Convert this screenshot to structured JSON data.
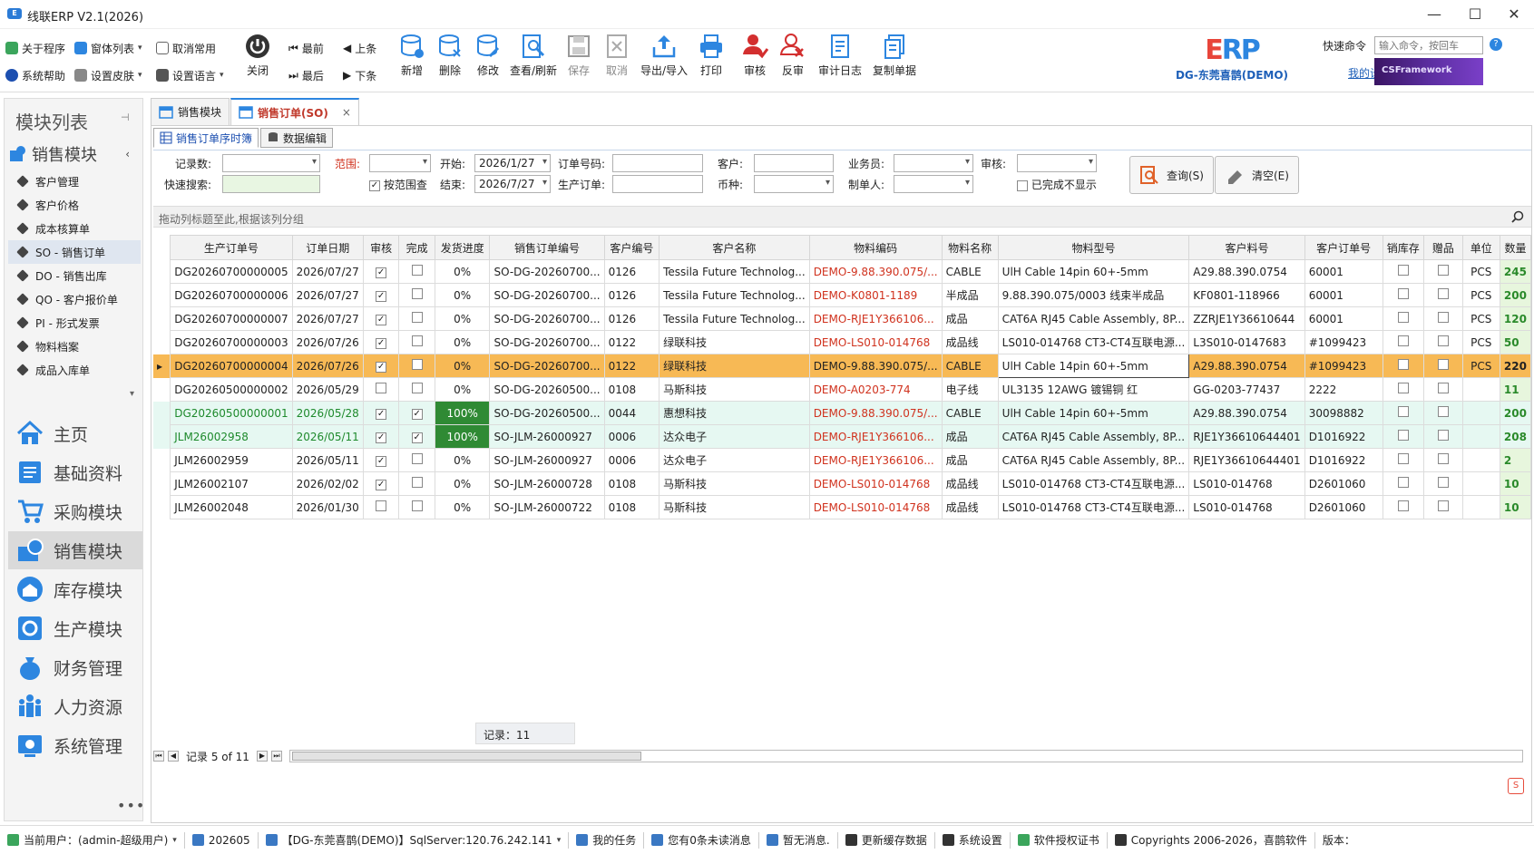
{
  "window": {
    "title": "线联ERP V2.1(2026)",
    "logo": "erp-logo-icon"
  },
  "ribbon": {
    "about": "关于程序",
    "window_list": "窗体列表",
    "cancel_favorite": "取消常用",
    "help": "系统帮助",
    "skin": "设置皮肤",
    "language": "设置语言",
    "close": "关闭",
    "first": "最前",
    "prev": "上条",
    "last": "最后",
    "next": "下条",
    "add": "新增",
    "delete": "删除",
    "edit": "修改",
    "view_refresh": "查看/刷新",
    "save": "保存",
    "cancel": "取消",
    "export_import": "导出/导入",
    "print": "打印",
    "approve": "审核",
    "unapprove": "反审",
    "audit_log": "审计日志",
    "copy_doc": "复制单据"
  },
  "brand": {
    "logo_text": "ERP",
    "org": "DG-东莞喜鹊(DEMO)",
    "cmd_label": "快速命令",
    "cmd_placeholder": "输入命令，按回车",
    "my_settings": "我的设置",
    "framework": "CSFramework",
    "help_icon": "?"
  },
  "sidebar": {
    "title": "模块列表",
    "pin": "ᵖ",
    "group": "销售模块",
    "items": [
      {
        "label": "客户管理"
      },
      {
        "label": "客户价格"
      },
      {
        "label": "成本核算单"
      },
      {
        "label": "SO - 销售订单"
      },
      {
        "label": "DO - 销售出库"
      },
      {
        "label": "QO - 客户报价单"
      },
      {
        "label": "PI - 形式发票"
      },
      {
        "label": "物料档案"
      },
      {
        "label": "成品入库单"
      }
    ],
    "nav": [
      {
        "label": "主页"
      },
      {
        "label": "基础资料"
      },
      {
        "label": "采购模块"
      },
      {
        "label": "销售模块"
      },
      {
        "label": "库存模块"
      },
      {
        "label": "生产模块"
      },
      {
        "label": "财务管理"
      },
      {
        "label": "人力资源"
      },
      {
        "label": "系统管理"
      }
    ],
    "more": "•••"
  },
  "tabs": [
    {
      "label": "销售模块"
    },
    {
      "label": "销售订单(SO)"
    }
  ],
  "subtabs": [
    {
      "label": "销售订单序时簿"
    },
    {
      "label": "数据编辑"
    }
  ],
  "filter": {
    "record_count": "记录数:",
    "quick_search": "快速搜索:",
    "range": "范围:",
    "by_range": "按范围查",
    "start": "开始:",
    "start_val": "2026/1/27",
    "end": "结束:",
    "end_val": "2026/7/27",
    "order_no": "订单号码:",
    "prod_order": "生产订单:",
    "customer": "客户:",
    "currency": "币种:",
    "salesman": "业务员:",
    "creator": "制单人:",
    "audit": "审核:",
    "hide_done": "已完成不显示",
    "query_btn": "查询(S)",
    "clear_btn": "清空(E)"
  },
  "group_hint": "拖动列标题至此,根据该列分组",
  "columns": [
    "生产订单号",
    "订单日期",
    "审核",
    "完成",
    "发货进度",
    "销售订单编号",
    "客户编号",
    "客户名称",
    "物料编码",
    "物料名称",
    "物料型号",
    "客户料号",
    "客户订单号",
    "销库存",
    "赠品",
    "单位",
    "数量"
  ],
  "rows": [
    {
      "prod": "DG20260700000005",
      "date": "2026/07/27",
      "aud": true,
      "done": false,
      "prog": "0%",
      "so": "SO-DG-20260700...",
      "cno": "0126",
      "cname": "Tessila Future Technolog...",
      "mcode": "DEMO-9.88.390.075/...",
      "mname": "CABLE",
      "model": "UlH Cable 14pin 60+-5mm",
      "cpn": "A29.88.390.0754",
      "cpo": "60001",
      "stock": false,
      "gift": false,
      "unit": "PCS",
      "qty": "245",
      "style": ""
    },
    {
      "prod": "DG20260700000006",
      "date": "2026/07/27",
      "aud": true,
      "done": false,
      "prog": "0%",
      "so": "SO-DG-20260700...",
      "cno": "0126",
      "cname": "Tessila Future Technolog...",
      "mcode": "DEMO-K0801-1189",
      "mname": "半成品",
      "model": "9.88.390.075/0003 线束半成品",
      "cpn": "KF0801-118966",
      "cpo": "60001",
      "stock": false,
      "gift": false,
      "unit": "PCS",
      "qty": "200",
      "style": ""
    },
    {
      "prod": "DG20260700000007",
      "date": "2026/07/27",
      "aud": true,
      "done": false,
      "prog": "0%",
      "so": "SO-DG-20260700...",
      "cno": "0126",
      "cname": "Tessila Future Technolog...",
      "mcode": "DEMO-RJE1Y366106...",
      "mname": "成品",
      "model": "CAT6A RJ45 Cable Assembly, 8P...",
      "cpn": "ZZRJE1Y36610644",
      "cpo": "60001",
      "stock": false,
      "gift": false,
      "unit": "PCS",
      "qty": "120",
      "style": ""
    },
    {
      "prod": "DG20260700000003",
      "date": "2026/07/26",
      "aud": true,
      "done": false,
      "prog": "0%",
      "so": "SO-DG-20260700...",
      "cno": "0122",
      "cname": "绿联科技",
      "mcode": "DEMO-LS010-014768",
      "mname": "成品线",
      "model": "LS010-014768 CT3-CT4互联电源...",
      "cpn": "L3S010-0147683",
      "cpo": "#1099423",
      "stock": false,
      "gift": false,
      "unit": "PCS",
      "qty": "50",
      "style": ""
    },
    {
      "prod": "DG20260700000004",
      "date": "2026/07/26",
      "aud": true,
      "done": false,
      "prog": "0%",
      "so": "SO-DG-20260700...",
      "cno": "0122",
      "cname": "绿联科技",
      "mcode": "DEMO-9.88.390.075/...",
      "mname": "CABLE",
      "model": "UlH Cable 14pin 60+-5mm",
      "cpn": "A29.88.390.0754",
      "cpo": "#1099423",
      "stock": false,
      "gift": false,
      "unit": "PCS",
      "qty": "220",
      "style": "sel"
    },
    {
      "prod": "DG20260500000002",
      "date": "2026/05/29",
      "aud": false,
      "done": false,
      "prog": "0%",
      "so": "SO-DG-20260500...",
      "cno": "0108",
      "cname": "马斯科技",
      "mcode": "DEMO-A0203-774",
      "mname": "电子线",
      "model": "UL3135 12AWG 镀锡铜 红",
      "cpn": "GG-0203-77437",
      "cpo": "2222",
      "stock": false,
      "gift": false,
      "unit": "",
      "qty": "11",
      "style": ""
    },
    {
      "prod": "DG20260500000001",
      "date": "2026/05/28",
      "aud": true,
      "done": true,
      "prog": "100%",
      "so": "SO-DG-20260500...",
      "cno": "0044",
      "cname": "惠想科技",
      "mcode": "DEMO-9.88.390.075/...",
      "mname": "CABLE",
      "model": "UlH Cable 14pin 60+-5mm",
      "cpn": "A29.88.390.0754",
      "cpo": "30098882",
      "stock": false,
      "gift": false,
      "unit": "",
      "qty": "200",
      "style": "green"
    },
    {
      "prod": "JLM26002958",
      "date": "2026/05/11",
      "aud": true,
      "done": true,
      "prog": "100%",
      "so": "SO-JLM-26000927",
      "cno": "0006",
      "cname": "达众电子",
      "mcode": "DEMO-RJE1Y366106...",
      "mname": "成品",
      "model": "CAT6A RJ45 Cable Assembly, 8P...",
      "cpn": "RJE1Y36610644401",
      "cpo": "D1016922",
      "stock": false,
      "gift": false,
      "unit": "",
      "qty": "208",
      "style": "green"
    },
    {
      "prod": "JLM26002959",
      "date": "2026/05/11",
      "aud": true,
      "done": false,
      "prog": "0%",
      "so": "SO-JLM-26000927",
      "cno": "0006",
      "cname": "达众电子",
      "mcode": "DEMO-RJE1Y366106...",
      "mname": "成品",
      "model": "CAT6A RJ45 Cable Assembly, 8P...",
      "cpn": "RJE1Y36610644401",
      "cpo": "D1016922",
      "stock": false,
      "gift": false,
      "unit": "",
      "qty": "2",
      "style": ""
    },
    {
      "prod": "JLM26002107",
      "date": "2026/02/02",
      "aud": true,
      "done": false,
      "prog": "0%",
      "so": "SO-JLM-26000728",
      "cno": "0108",
      "cname": "马斯科技",
      "mcode": "DEMO-LS010-014768",
      "mname": "成品线",
      "model": "LS010-014768 CT3-CT4互联电源...",
      "cpn": "LS010-014768",
      "cpo": "D2601060",
      "stock": false,
      "gift": false,
      "unit": "",
      "qty": "10",
      "style": ""
    },
    {
      "prod": "JLM26002048",
      "date": "2026/01/30",
      "aud": false,
      "done": false,
      "prog": "0%",
      "so": "SO-JLM-26000722",
      "cno": "0108",
      "cname": "马斯科技",
      "mcode": "DEMO-LS010-014768",
      "mname": "成品线",
      "model": "LS010-014768 CT3-CT4互联电源...",
      "cpn": "LS010-014768",
      "cpo": "D2601060",
      "stock": false,
      "gift": false,
      "unit": "",
      "qty": "10",
      "style": ""
    }
  ],
  "footer": {
    "records": "记录：11",
    "pager": "记录 5 of 11"
  },
  "status": {
    "user": "当前用户：(admin-超级用户)",
    "period": "202605",
    "db": "【DG-东莞喜鹊(DEMO)】SqlServer:120.76.242.141",
    "tasks": "我的任务",
    "unread": "您有0条未读消息",
    "no_msg": "暂无消息.",
    "refresh_cache": "更新缓存数据",
    "sys_settings": "系统设置",
    "license": "软件授权证书",
    "copyright": "Copyrights 2006-2026，喜鹊软件",
    "version": "版本："
  },
  "colors": {
    "accent": "#2d86e0",
    "selected_row": "#f7b955",
    "done_row": "#e6f8f2",
    "progress_done": "#2f8a34",
    "material_code": "#d0321e"
  }
}
